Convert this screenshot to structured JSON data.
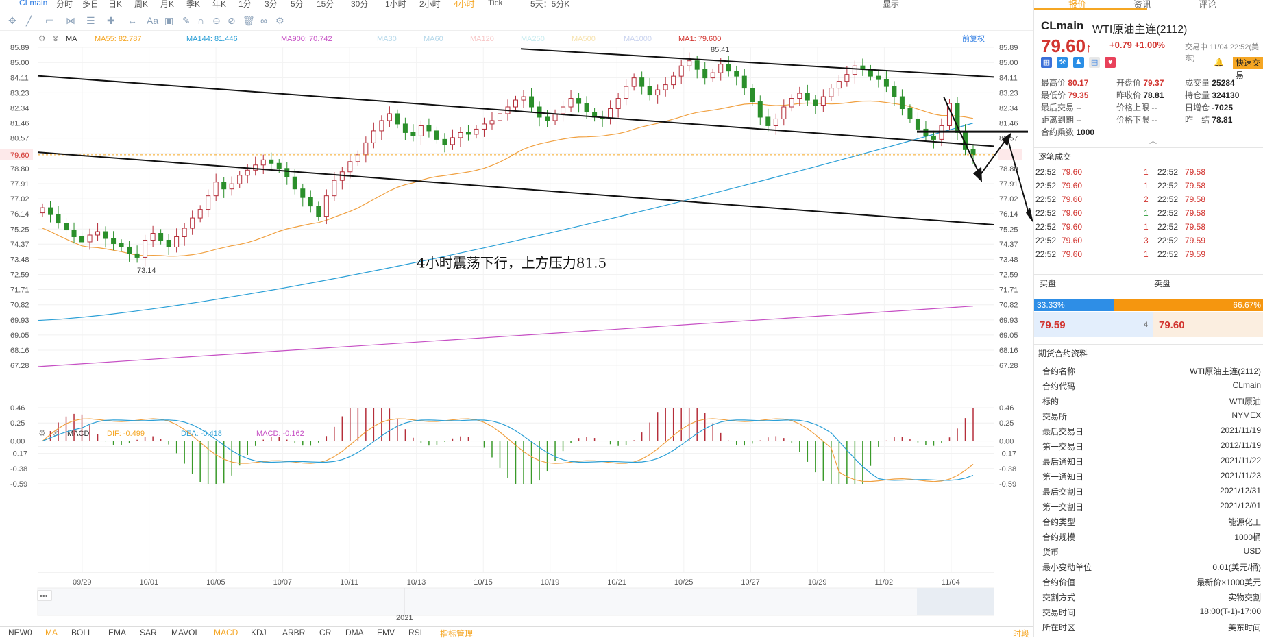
{
  "top": {
    "symbol": "CLmain",
    "periods": [
      "分时",
      "多日",
      "日K",
      "周K",
      "月K",
      "季K",
      "年K",
      "1分",
      "3分",
      "5分",
      "15分",
      "30分",
      "1小时",
      "2小时",
      "4小时",
      "Tick",
      "5天：5分K"
    ],
    "active_period": "4小时",
    "display": "显示"
  },
  "ma_legend": {
    "ma_label": "MA",
    "items": [
      {
        "text": "MA55: 82.787",
        "color": "#f5a623"
      },
      {
        "text": "MA144: 81.446",
        "color": "#2a9fd6"
      },
      {
        "text": "MA900: 70.742",
        "color": "#c64fc4"
      },
      {
        "text": "MA30",
        "color": "#b5d8ea"
      },
      {
        "text": "MA60",
        "color": "#b5d8ea"
      },
      {
        "text": "MA120",
        "color": "#f7c6c6"
      },
      {
        "text": "MA250",
        "color": "#c8ecf0"
      },
      {
        "text": "MA500",
        "color": "#f7e3b0"
      },
      {
        "text": "MA1000",
        "color": "#c9d3ef"
      },
      {
        "text": "MA1: 79.600",
        "color": "#d2342f"
      }
    ],
    "fuquan": "前复权"
  },
  "macd_legend": {
    "label": "MACD",
    "dif": "DIF: -0.499",
    "dea": "DEA: -0.418",
    "macd": "MACD: -0.162"
  },
  "annotation": "4小时震荡下行，上方压力81.5",
  "navigator_year": "2021",
  "bottom_tabs": [
    "NEW0",
    "MA",
    "BOLL",
    "EMA",
    "SAR",
    "MAVOL",
    "MACD",
    "KDJ",
    "ARBR",
    "CR",
    "DMA",
    "EMV",
    "RSI",
    "指标管理"
  ],
  "bottom_right": "时段",
  "chart_data": {
    "type": "candlestick",
    "price_axis": {
      "ticks": [
        "85.89",
        "85.00",
        "84.11",
        "83.23",
        "82.34",
        "81.46",
        "80.57",
        "79.68",
        "78.80",
        "77.91",
        "77.02",
        "76.14",
        "75.25",
        "74.37",
        "73.48",
        "72.59",
        "71.71",
        "70.82",
        "69.93",
        "69.05",
        "68.16",
        "67.28"
      ],
      "min": 67.28,
      "max": 85.89,
      "last": "79.60"
    },
    "macd_axis": {
      "ticks": [
        "0.46",
        "0.25",
        "0.00",
        "-0.17",
        "-0.38",
        "-0.59"
      ],
      "min": -0.59,
      "max": 0.46
    },
    "x_labels": [
      "09/29",
      "10/01",
      "10/05",
      "10/07",
      "10/11",
      "10/13",
      "10/15",
      "10/19",
      "10/21",
      "10/25",
      "10/27",
      "10/29",
      "11/02",
      "11/04"
    ],
    "high_label": "85.41",
    "low_label": "73.14",
    "closes": [
      76.5,
      76.1,
      75.6,
      75.2,
      74.8,
      74.5,
      74.9,
      75.1,
      74.7,
      74.4,
      74.2,
      73.8,
      73.6,
      74.6,
      75.0,
      74.6,
      74.2,
      74.8,
      75.3,
      75.9,
      76.4,
      77.2,
      78.0,
      77.6,
      77.9,
      78.4,
      78.7,
      79.0,
      79.3,
      79.1,
      78.8,
      78.3,
      77.6,
      77.1,
      76.6,
      76.0,
      77.2,
      78.1,
      78.6,
      79.2,
      79.6,
      80.3,
      81.0,
      81.6,
      82.0,
      81.4,
      80.9,
      80.7,
      81.3,
      81.0,
      80.5,
      80.2,
      80.6,
      80.9,
      80.8,
      81.1,
      81.4,
      81.6,
      82.0,
      82.4,
      82.8,
      83.0,
      82.4,
      81.8,
      81.6,
      82.0,
      82.4,
      82.9,
      82.6,
      82.1,
      81.8,
      81.7,
      82.3,
      82.9,
      83.6,
      84.1,
      83.6,
      83.1,
      83.4,
      83.7,
      84.2,
      84.8,
      85.1,
      84.6,
      84.1,
      84.4,
      84.9,
      84.5,
      84.2,
      83.5,
      82.7,
      81.8,
      81.3,
      81.7,
      82.4,
      82.9,
      83.2,
      82.8,
      82.5,
      83.0,
      83.5,
      83.9,
      84.3,
      84.8,
      84.6,
      84.2,
      84.0,
      83.6,
      83.0,
      82.3,
      81.7,
      81.1,
      80.7,
      80.5,
      81.3,
      82.6,
      80.9,
      79.9,
      79.6
    ]
  },
  "right": {
    "tabs": [
      "报价",
      "资讯",
      "评论"
    ],
    "symbol": "CLmain",
    "name": "WTI原油主连(2112)",
    "price": "79.60",
    "arrow": "↑",
    "change": "+0.79",
    "pct": "+1.00%",
    "trade_status": "交易中 11/04 22:52(美东)",
    "quick": "快速交易",
    "stats": [
      [
        [
          "最高价",
          "80.17",
          "red"
        ],
        [
          "开盘价",
          "79.37",
          "red"
        ],
        [
          "成交量",
          "25284",
          "blk"
        ]
      ],
      [
        [
          "最低价",
          "79.35",
          "red"
        ],
        [
          "昨收价",
          "78.81",
          "blk"
        ],
        [
          "持仓量",
          "324130",
          "blk"
        ]
      ],
      [
        [
          "最后交易",
          "--",
          "lbl"
        ],
        [
          "价格上限",
          "--",
          "lbl"
        ],
        [
          "日增仓",
          "-7025",
          "blk"
        ]
      ],
      [
        [
          "距离到期",
          "--",
          "lbl"
        ],
        [
          "价格下限",
          "--",
          "lbl"
        ],
        [
          "昨　结",
          "78.81",
          "blk"
        ]
      ],
      [
        [
          "合约乘数",
          "1000",
          "blk"
        ]
      ]
    ],
    "ticks_title": "逐笔成交",
    "ticks": [
      [
        "22:52",
        "79.60",
        "1",
        "22:52",
        "79.58"
      ],
      [
        "22:52",
        "79.60",
        "1",
        "22:52",
        "79.58"
      ],
      [
        "22:52",
        "79.60",
        "2",
        "22:52",
        "79.58"
      ],
      [
        "22:52",
        "79.60",
        "1",
        "22:52",
        "79.58"
      ],
      [
        "22:52",
        "79.60",
        "1",
        "22:52",
        "79.58"
      ],
      [
        "22:52",
        "79.60",
        "3",
        "22:52",
        "79.59"
      ],
      [
        "22:52",
        "79.60",
        "1",
        "22:52",
        "79.59"
      ]
    ],
    "buy_label": "买盘",
    "sell_label": "卖盘",
    "buy_pct": "33.33%",
    "sell_pct": "66.67%",
    "bid": "79.59",
    "bid_qty": "4",
    "ask": "79.60",
    "info_title": "期货合约资料",
    "info": [
      [
        "合约名称",
        "WTI原油主连(2112)"
      ],
      [
        "合约代码",
        "CLmain"
      ],
      [
        "标的",
        "WTI原油"
      ],
      [
        "交易所",
        "NYMEX"
      ],
      [
        "最后交易日",
        "2021/11/19"
      ],
      [
        "第一交易日",
        "2012/11/19"
      ],
      [
        "最后通知日",
        "2021/11/22"
      ],
      [
        "第一通知日",
        "2021/11/23"
      ],
      [
        "最后交割日",
        "2021/12/31"
      ],
      [
        "第一交割日",
        "2021/12/01"
      ],
      [
        "合约类型",
        "能源化工"
      ],
      [
        "合约规模",
        "1000桶"
      ],
      [
        "货币",
        "USD"
      ],
      [
        "最小变动单位",
        "0.01(美元/桶)"
      ],
      [
        "合约价值",
        "最新价×1000美元"
      ],
      [
        "交割方式",
        "实物交割"
      ],
      [
        "交易时间",
        "18:00(T-1)-17:00"
      ],
      [
        "所在时区",
        "美东时间"
      ]
    ]
  }
}
